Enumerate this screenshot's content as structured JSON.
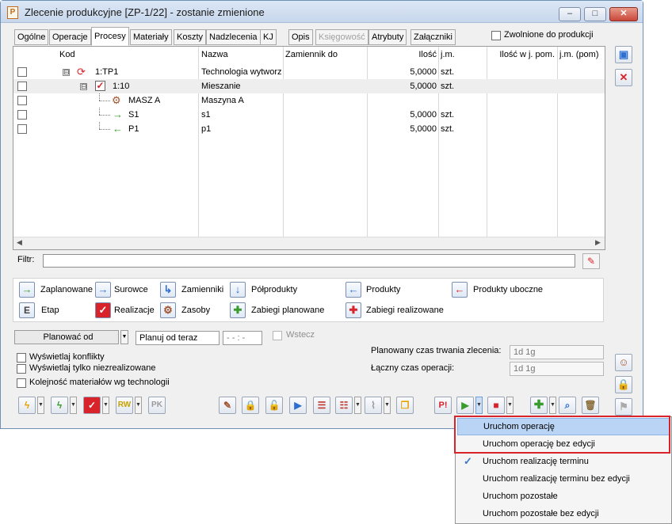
{
  "window": {
    "title": "Zlecenie produkcyjne  [ZP-1/22] - zostanie zmienione",
    "app_icon": "P",
    "controls": {
      "minimize": "–",
      "maximize": "□",
      "close": "✕"
    }
  },
  "tabs": [
    {
      "label": "Ogólne"
    },
    {
      "label": "Operacje"
    },
    {
      "label": "Procesy"
    },
    {
      "label": "Materiały"
    },
    {
      "label": "Koszty"
    },
    {
      "label": "Nadzlecenia"
    },
    {
      "label": "KJ"
    },
    {
      "label": "Opis"
    },
    {
      "label": "Księgowość"
    },
    {
      "label": "Atrybuty"
    },
    {
      "label": "Załączniki"
    }
  ],
  "released_for_production": {
    "label": "Zwolnione do produkcji",
    "checked": false
  },
  "grid": {
    "columns": {
      "code": "Kod",
      "name": "Nazwa",
      "substitute": "Zamiennik do",
      "qty": "Ilość",
      "unit": "j.m.",
      "qty_aux": "Ilość w j. pom.",
      "unit_aux": "j.m. (pom)"
    },
    "rows": [
      {
        "tree": "⊟",
        "icon": "process-icon",
        "code": "1:TP1",
        "name": "Technologia wytworz",
        "qty": "5,0000",
        "unit": "szt."
      },
      {
        "tree": "⊟",
        "icon": "stage-done-icon",
        "code": "1:10",
        "name": "Mieszanie",
        "qty": "5,0000",
        "unit": "szt."
      },
      {
        "tree": "",
        "icon": "resource-icon",
        "code": "MASZ A",
        "name": "Maszyna A",
        "qty": "",
        "unit": ""
      },
      {
        "tree": "",
        "icon": "raw-material-arrow-icon",
        "code": "S1",
        "name": "s1",
        "qty": "5,0000",
        "unit": "szt."
      },
      {
        "tree": "",
        "icon": "product-arrow-icon",
        "code": "P1",
        "name": "p1",
        "qty": "5,0000",
        "unit": "szt."
      }
    ]
  },
  "filter": {
    "label": "Filtr:",
    "value": ""
  },
  "legend": [
    {
      "label": "Zaplanowane"
    },
    {
      "label": "Surowce"
    },
    {
      "label": "Zamienniki"
    },
    {
      "label": "Półprodukty"
    },
    {
      "label": "Produkty"
    },
    {
      "label": "Produkty uboczne"
    },
    {
      "label": "Etap"
    },
    {
      "label": "Realizacje"
    },
    {
      "label": "Zasoby"
    },
    {
      "label": "Zabiegi planowane"
    },
    {
      "label": "Zabiegi realizowane"
    }
  ],
  "planning": {
    "plan_from_label": "Planować od",
    "plan_mode": "Planuj od teraz",
    "time_value": "- - : -",
    "backward_label": "Wstecz",
    "planned_duration_label": "Planowany czas trwania zlecenia:",
    "planned_duration_value": "1d 1g",
    "total_time_label": "Łączny czas operacji:",
    "total_time_value": "1d 1g"
  },
  "options": [
    {
      "label": "Wyświetlaj konflikty"
    },
    {
      "label": "Wyświetlaj tylko niezrealizowane"
    },
    {
      "label": "Kolejność materiałów wg technologii"
    }
  ],
  "dropdown_menu": [
    {
      "label": "Uruchom operację",
      "highlighted": true,
      "checked": false
    },
    {
      "label": "Uruchom operację bez edycji",
      "highlighted": false,
      "checked": false
    },
    {
      "label": "Uruchom realizację terminu",
      "highlighted": false,
      "checked": true
    },
    {
      "label": "Uruchom realizację terminu bez edycji",
      "highlighted": false,
      "checked": false
    },
    {
      "label": "Uruchom pozostałe",
      "highlighted": false,
      "checked": false
    },
    {
      "label": "Uruchom pozostałe bez edycji",
      "highlighted": false,
      "checked": false
    }
  ],
  "colors": {
    "accent": "#3b79c7",
    "highlight": "#b9d4f4",
    "red_frame": "#d8232a"
  }
}
